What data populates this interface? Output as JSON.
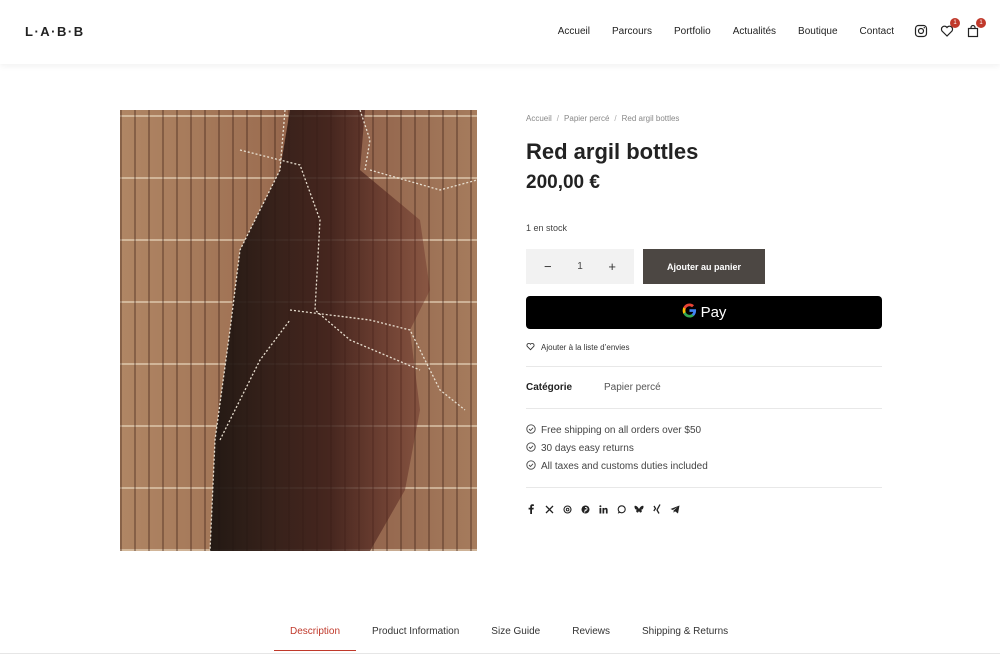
{
  "header": {
    "logo": "L·A·B·B",
    "nav": [
      "Accueil",
      "Parcours",
      "Portfolio",
      "Actualités",
      "Boutique",
      "Contact"
    ],
    "wishlist_count": "1",
    "cart_count": "1"
  },
  "breadcrumb": [
    "Accueil",
    "Papier percé",
    "Red argil bottles"
  ],
  "product": {
    "title": "Red argil bottles",
    "price": "200,00 €",
    "stock": "1 en stock",
    "quantity": "1",
    "add_to_cart": "Ajouter au panier",
    "gpay_label": "Pay",
    "wishlist": "Ajouter à la liste d’envies",
    "category_label": "Catégorie",
    "category_value": "Papier percé"
  },
  "perks": [
    "Free shipping on all orders over $50",
    "30 days easy returns",
    "All taxes and customs duties included"
  ],
  "share_icons": [
    "facebook-icon",
    "x-icon",
    "threads-icon",
    "pinterest-icon",
    "linkedin-icon",
    "whatsapp-icon",
    "bluesky-icon",
    "xing-icon",
    "telegram-icon"
  ],
  "tabs": [
    "Description",
    "Product Information",
    "Size Guide",
    "Reviews",
    "Shipping & Returns"
  ],
  "colors": {
    "accent": "#c0392b",
    "button": "#4c4743"
  }
}
